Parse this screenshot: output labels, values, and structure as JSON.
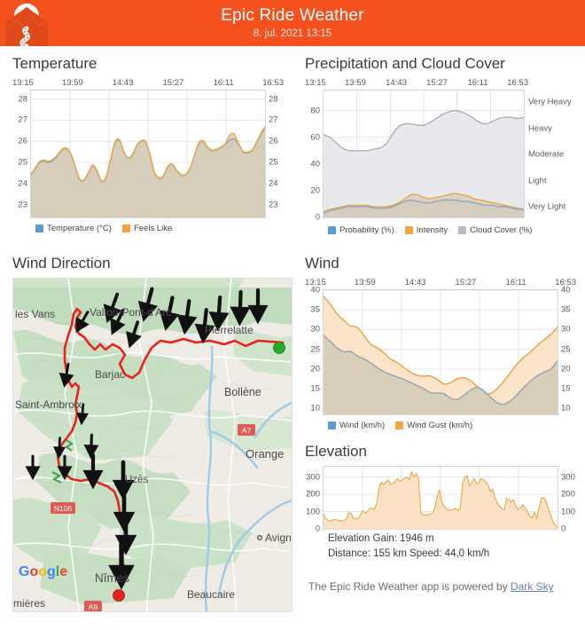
{
  "header": {
    "title": "Epic Ride Weather",
    "date": "8. jul. 2021 13:15",
    "logo_icon": "mountain-road-logo",
    "bg_color": "#f4511e"
  },
  "panels": {
    "temperature": {
      "title": "Temperature",
      "legend": [
        {
          "label": "Temperature (°C)",
          "color": "#5b9bd5"
        },
        {
          "label": "Feels Like",
          "color": "#f5a33c"
        }
      ]
    },
    "precipitation": {
      "title": "Precipitation and Cloud Cover",
      "legend": [
        {
          "label": "Probability (%)",
          "color": "#5b9bd5"
        },
        {
          "label": "Intensity",
          "color": "#f5a33c"
        },
        {
          "label": "Cloud Cover (%)",
          "color": "#b9b9c4"
        }
      ]
    },
    "wind_direction": {
      "title": "Wind Direction",
      "map": {
        "attribution": "Google",
        "start_marker_color": "#39b54a",
        "end_marker_color": "#e8231e",
        "route_color": "#e8231e",
        "labels": [
          "les Vans",
          "Vallon-Pont-d'Arc",
          "Barjac",
          "Saint-Ambroix",
          "Pierrelatte",
          "Bollène",
          "Orange",
          "Uzès",
          "Nîmes",
          "Avignon",
          "Beaucaire",
          "mières"
        ],
        "road_shields": [
          "A7",
          "N106",
          "A9"
        ]
      }
    },
    "wind": {
      "title": "Wind",
      "legend": [
        {
          "label": "Wind (km/h)",
          "color": "#5b9bd5"
        },
        {
          "label": "Wind Gust (km/h)",
          "color": "#f5a33c"
        }
      ]
    },
    "elevation": {
      "title": "Elevation",
      "gain": "Elevation Gain: 1946 m",
      "distance_speed": "Distance: 155 km  Speed: 44,0 km/h"
    }
  },
  "footer": {
    "text_before": "The Epic Ride Weather app is powered by ",
    "link_label": "Dark Sky"
  },
  "chart_data": [
    {
      "id": "temperature",
      "type": "area",
      "title": "Temperature",
      "xlabel": "",
      "ylabel": "°C",
      "xticks": [
        "13:15",
        "13:59",
        "14:43",
        "15:27",
        "16:11",
        "16:53"
      ],
      "yticks": [
        23,
        24,
        25,
        26,
        27,
        28
      ],
      "ylim": [
        22.4,
        28.4
      ],
      "grid": true,
      "legend_position": "bottom",
      "series": [
        {
          "name": "Temperature (°C)",
          "color": "#5b9bd5",
          "values": [
            24.4,
            24.7,
            25.0,
            25.05,
            25.0,
            25.1,
            25.3,
            25.6,
            25.65,
            25.4,
            24.8,
            24.2,
            24.15,
            24.5,
            24.85,
            24.55,
            24.1,
            24.3,
            25.1,
            25.9,
            26.05,
            25.5,
            25.2,
            25.35,
            25.8,
            26.0,
            25.95,
            25.3,
            24.5,
            24.25,
            24.35,
            24.8,
            24.9,
            24.6,
            24.4,
            24.4,
            24.7,
            25.3,
            25.9,
            26.0,
            25.7,
            25.55,
            25.6,
            25.7,
            25.85,
            26.05,
            26.1,
            25.85,
            25.5,
            25.45,
            25.55,
            25.9,
            26.3,
            26.65
          ]
        },
        {
          "name": "Feels Like",
          "color": "#f5a33c",
          "values": [
            24.45,
            24.75,
            25.05,
            25.1,
            25.05,
            25.15,
            25.35,
            25.62,
            25.68,
            25.42,
            24.82,
            24.22,
            24.18,
            24.52,
            24.88,
            24.58,
            24.12,
            24.32,
            25.12,
            25.95,
            26.08,
            25.52,
            25.22,
            25.38,
            25.82,
            26.02,
            25.97,
            25.32,
            24.52,
            24.28,
            24.38,
            24.82,
            24.92,
            24.62,
            24.42,
            24.42,
            24.72,
            25.32,
            25.92,
            26.02,
            25.72,
            25.58,
            25.62,
            25.72,
            25.88,
            26.28,
            26.35,
            25.9,
            25.52,
            25.48,
            25.58,
            25.92,
            26.35,
            26.7
          ]
        }
      ]
    },
    {
      "id": "precipitation",
      "type": "area",
      "title": "Precipitation and Cloud Cover",
      "xticks": [
        "13:15",
        "13:59",
        "14:43",
        "15:27",
        "16:11",
        "16:53"
      ],
      "yticks_left": [
        0,
        20,
        40,
        60,
        80
      ],
      "yticks_right": [
        "Very Light",
        "Light",
        "Moderate",
        "Heavy",
        "Very Heavy"
      ],
      "ylim": [
        0,
        95
      ],
      "grid": true,
      "legend_position": "bottom",
      "series": [
        {
          "name": "Cloud Cover (%)",
          "color": "#b9b9c4",
          "values": [
            62,
            60,
            56,
            52,
            50,
            50,
            50,
            50,
            51,
            52,
            55,
            62,
            68,
            70,
            70,
            69,
            69,
            71,
            74,
            77,
            79,
            80,
            79,
            77,
            74,
            71,
            70,
            72,
            74,
            75,
            75,
            74,
            75
          ]
        },
        {
          "name": "Intensity",
          "color": "#f5a33c",
          "values": [
            4,
            6,
            7,
            8,
            9,
            9,
            9,
            9,
            8,
            8,
            8,
            9,
            11,
            14,
            17,
            17,
            15,
            14,
            15,
            16,
            17,
            18,
            17,
            16,
            14,
            13,
            12,
            11,
            10,
            9,
            8,
            7,
            6
          ]
        },
        {
          "name": "Probability (%)",
          "color": "#5b9bd5",
          "values": [
            3,
            5,
            6,
            7,
            8,
            8,
            8,
            8,
            7,
            7,
            7,
            8,
            10,
            12,
            13,
            12,
            11,
            11,
            12,
            13,
            13,
            13,
            12,
            12,
            11,
            10,
            9,
            9,
            8,
            8,
            7,
            6,
            6
          ]
        }
      ]
    },
    {
      "id": "wind",
      "type": "area",
      "title": "Wind",
      "xticks": [
        "13:15",
        "13:59",
        "14:43",
        "15:27",
        "16:11",
        "16:53"
      ],
      "yticks": [
        10,
        15,
        20,
        25,
        30,
        35,
        40
      ],
      "ylim": [
        8.5,
        40
      ],
      "grid": true,
      "legend_position": "bottom",
      "series": [
        {
          "name": "Wind Gust (km/h)",
          "color": "#f5a33c",
          "values": [
            38.4,
            36.5,
            34.0,
            32.4,
            31.0,
            30.6,
            28.6,
            26.4,
            25.4,
            24.2,
            22.6,
            21.6,
            20.4,
            19.2,
            18.4,
            18.2,
            18.2,
            17.4,
            16.2,
            16.6,
            17.5,
            17.8,
            17.0,
            15.6,
            14.0,
            13.8,
            15.0,
            17.0,
            19.2,
            21.4,
            23.0,
            24.4,
            26.0,
            27.4,
            28.8,
            30.6
          ]
        },
        {
          "name": "Wind (km/h)",
          "color": "#5b9bd5",
          "values": [
            28.6,
            27.0,
            25.4,
            24.4,
            24.5,
            23.4,
            22.6,
            21.6,
            20.4,
            19.4,
            18.6,
            18.0,
            17.4,
            16.6,
            15.8,
            15.0,
            14.0,
            13.9,
            13.7,
            12.6,
            12.3,
            13.4,
            14.6,
            15.4,
            14.4,
            12.8,
            11.4,
            11.1,
            12.0,
            13.6,
            15.4,
            17.0,
            18.3,
            19.2,
            20.0,
            22.0
          ]
        }
      ]
    },
    {
      "id": "elevation",
      "type": "area",
      "title": "Elevation",
      "yticks": [
        0,
        100,
        200,
        300
      ],
      "ylim": [
        0,
        360
      ],
      "grid": true,
      "color": "#f5a33c",
      "values": [
        85,
        60,
        48,
        44,
        50,
        55,
        50,
        46,
        44,
        48,
        60,
        95,
        88,
        60,
        58,
        62,
        80,
        105,
        90,
        100,
        120,
        118,
        112,
        150,
        240,
        270,
        255,
        275,
        282,
        258,
        262,
        278,
        290,
        275,
        285,
        292,
        300,
        285,
        330,
        300,
        320,
        290,
        95,
        82,
        80,
        82,
        85,
        90,
        120,
        180,
        228,
        160,
        130,
        120,
        110,
        108,
        112,
        120,
        108,
        118,
        260,
        300,
        308,
        250,
        268,
        290,
        262,
        268,
        290,
        285,
        272,
        255,
        215,
        230,
        180,
        150,
        130,
        118,
        112,
        175,
        168,
        155,
        170,
        130,
        112,
        120,
        140,
        122,
        100,
        75,
        62,
        95,
        60,
        118,
        175,
        182,
        160,
        120,
        80,
        45,
        20,
        8
      ],
      "stats": {
        "gain": "1946 m",
        "distance": "155 km",
        "speed": "44,0 km/h"
      }
    }
  ]
}
